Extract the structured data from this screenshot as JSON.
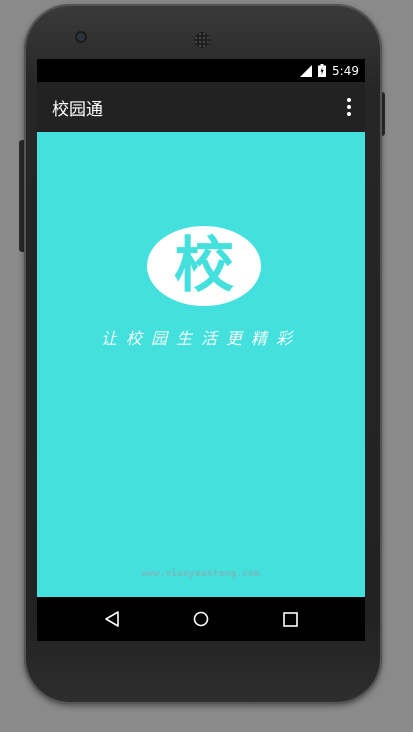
{
  "status_bar": {
    "time": "5:49"
  },
  "action_bar": {
    "title": "校园通",
    "overflow_icon": "more-vert-icon"
  },
  "splash": {
    "logo_char": "校",
    "slogan": "让校园生活更精彩",
    "footer_url": "www.xiaoyuantong.com"
  },
  "colors": {
    "content_bg": "#44e0de",
    "action_bar_bg": "#222222"
  },
  "nav_bar": {
    "icons": [
      "back-icon",
      "home-icon",
      "recents-icon"
    ]
  }
}
